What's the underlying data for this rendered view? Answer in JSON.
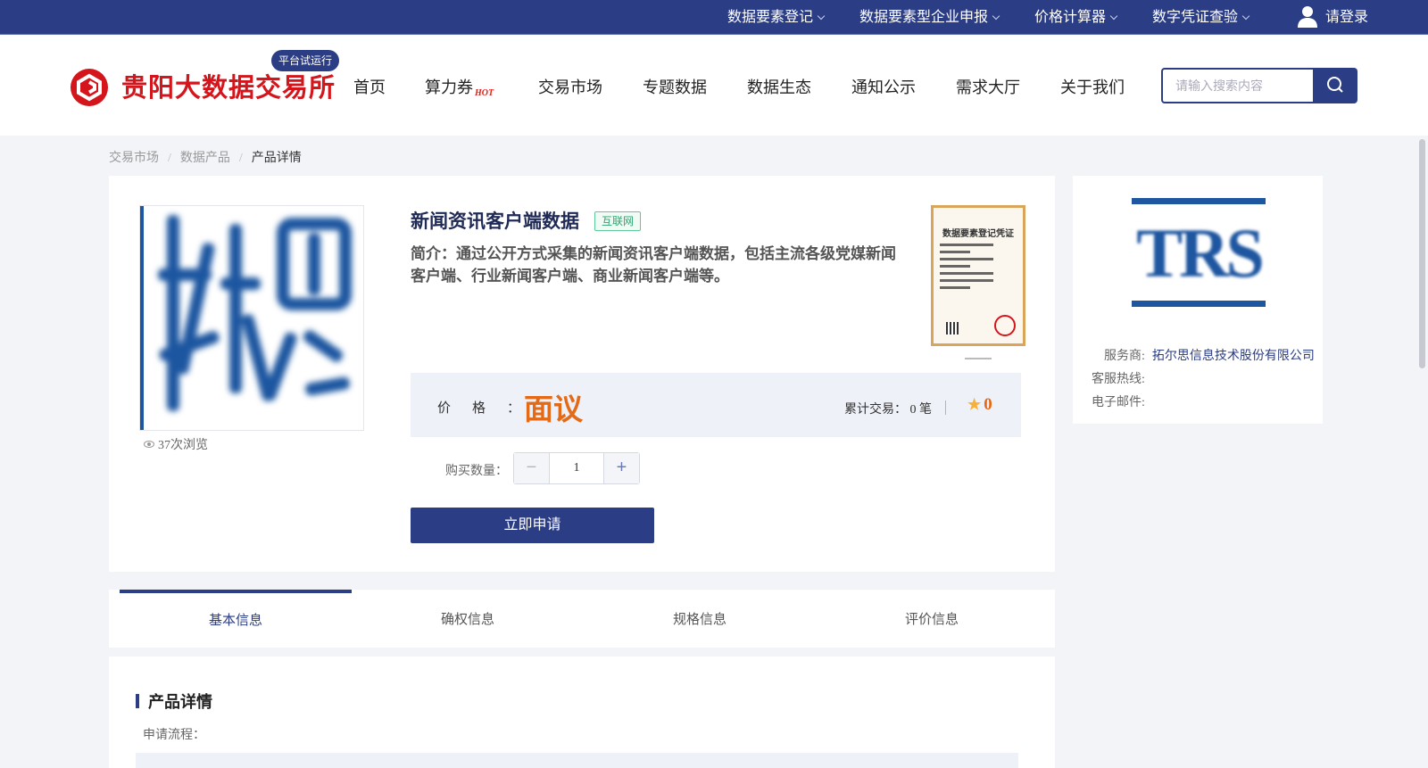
{
  "topbar": {
    "items": [
      {
        "label": "数据要素登记"
      },
      {
        "label": "数据要素型企业申报"
      },
      {
        "label": "价格计算器"
      },
      {
        "label": "数字凭证查验"
      }
    ],
    "login_label": "请登录"
  },
  "header": {
    "brand": "贵阳大数据交易所",
    "trial_badge": "平台试运行",
    "nav": [
      {
        "label": "首页"
      },
      {
        "label": "算力券",
        "badge": "HOT"
      },
      {
        "label": "交易市场"
      },
      {
        "label": "专题数据"
      },
      {
        "label": "数据生态"
      },
      {
        "label": "通知公示"
      },
      {
        "label": "需求大厅"
      },
      {
        "label": "关于我们"
      }
    ],
    "search_placeholder": "请输入搜索内容"
  },
  "breadcrumb": {
    "items": [
      "交易市场",
      "数据产品"
    ],
    "separator": "/",
    "current": "产品详情"
  },
  "product": {
    "views": "37次浏览",
    "title": "新闻资讯客户端数据",
    "tag": "互联网",
    "intro": "简介：通过公开方式采集的新闻资讯客户端数据，包括主流各级党媒新闻客户端、行业新闻客户端、商业新闻客户端等。",
    "certificate_title": "数据要素登记凭证",
    "price_label": "价格：",
    "price_value": "面议",
    "trades_label": "累计交易：",
    "trades_value": "0 笔",
    "rating": "0",
    "quantity_label": "购买数量：",
    "quantity": "1",
    "apply_label": "立即申请"
  },
  "provider": {
    "logo_text": "TRS",
    "service_label": "服务商:",
    "service_value": "拓尔思信息技术股份有限公司",
    "hotline_label": "客服热线:",
    "email_label": "电子邮件:"
  },
  "tabs": [
    {
      "label": "基本信息",
      "active": true
    },
    {
      "label": "确权信息"
    },
    {
      "label": "规格信息"
    },
    {
      "label": "评价信息"
    }
  ],
  "details": {
    "section_title": "产品详情",
    "flow_label": "申请流程："
  },
  "colors": {
    "brand_blue": "#2b3d85",
    "brand_red": "#d4151c",
    "price_orange": "#e36a16",
    "tag_green": "#2ea56f"
  }
}
